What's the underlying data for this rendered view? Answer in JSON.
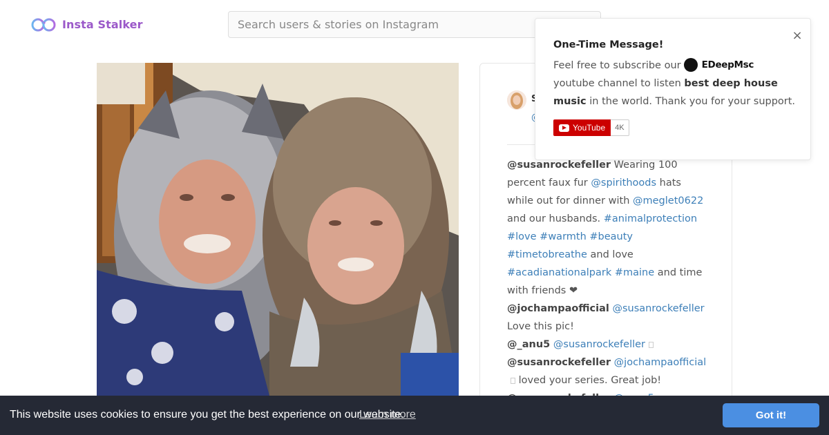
{
  "header": {
    "logo_text": "Insta Stalker",
    "search_placeholder": "Search users & stories on Instagram"
  },
  "post": {
    "user_name": "S",
    "user_handle": "@",
    "caption": [
      [
        {
          "t": "u",
          "v": "@susanrockefeller"
        },
        {
          "t": "p",
          "v": " Wearing 100 percent faux fur "
        },
        {
          "t": "l",
          "v": "@spirithoods"
        },
        {
          "t": "p",
          "v": " hats while out for dinner with "
        },
        {
          "t": "l",
          "v": "@meglet0622"
        },
        {
          "t": "p",
          "v": " and our husbands. "
        },
        {
          "t": "l",
          "v": "#animalprotection"
        },
        {
          "t": "p",
          "v": " "
        },
        {
          "t": "l",
          "v": "#love"
        },
        {
          "t": "p",
          "v": " "
        },
        {
          "t": "l",
          "v": "#warmth"
        },
        {
          "t": "p",
          "v": " "
        },
        {
          "t": "l",
          "v": "#beauty"
        },
        {
          "t": "p",
          "v": " "
        },
        {
          "t": "l",
          "v": "#timetobreathe"
        },
        {
          "t": "p",
          "v": " and love "
        },
        {
          "t": "l",
          "v": "#acadianationalpark"
        },
        {
          "t": "p",
          "v": " "
        },
        {
          "t": "l",
          "v": "#maine"
        },
        {
          "t": "p",
          "v": " and time with friends ❤"
        }
      ],
      [
        {
          "t": "u",
          "v": "@jochampaofficial"
        },
        {
          "t": "p",
          "v": " "
        },
        {
          "t": "l",
          "v": "@susanrockefeller"
        },
        {
          "t": "p",
          "v": " Love this pic!"
        }
      ],
      [
        {
          "t": "u",
          "v": "@_anu5"
        },
        {
          "t": "p",
          "v": " "
        },
        {
          "t": "l",
          "v": "@susanrockefeller"
        },
        {
          "t": "s",
          "v": ""
        }
      ],
      [
        {
          "t": "u",
          "v": "@susanrockefeller"
        },
        {
          "t": "p",
          "v": " "
        },
        {
          "t": "l",
          "v": "@jochampaofficial"
        },
        {
          "t": "s",
          "v": ""
        },
        {
          "t": "p",
          "v": " loved your series. Great job!"
        }
      ],
      [
        {
          "t": "u",
          "v": "@susanrockefeller"
        },
        {
          "t": "p",
          "v": " "
        },
        {
          "t": "l",
          "v": "@_anu5"
        },
        {
          "t": "s",
          "v": ""
        }
      ]
    ]
  },
  "popup": {
    "title": "One-Time Message!",
    "text_before": "Feel free to subscribe our",
    "channel_name": "EDeepMsc",
    "text_after": "youtube channel to listen",
    "bold_phrase": "best deep house music",
    "text_end": "in the world. Thank you for your support.",
    "close_symbol": "×",
    "youtube_label": "YouTube",
    "youtube_count": "4K"
  },
  "cookie": {
    "message": "This website uses cookies to ensure you get the best experience on our website.",
    "learn_more": "Learn more",
    "button": "Got it!"
  }
}
